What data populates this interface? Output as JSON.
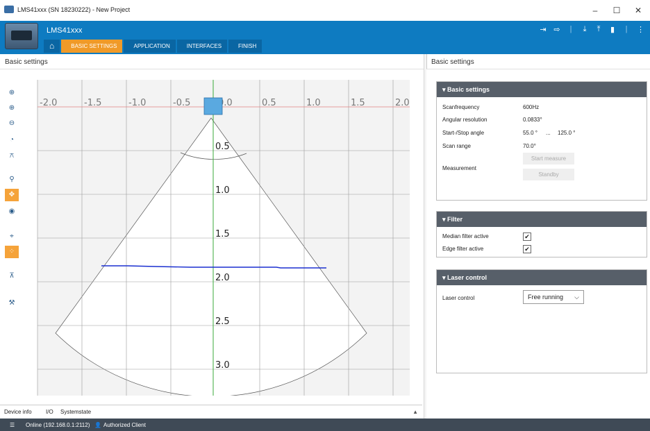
{
  "window": {
    "title": "LMS41xxx (SN 18230222) - New Project",
    "controls": [
      "–",
      "☐",
      "✕"
    ]
  },
  "header": {
    "device_name": "LMS41xxx",
    "icons": [
      "login-icon",
      "logout-icon",
      "download-icon",
      "upload-icon",
      "device-icon",
      "more-icon"
    ],
    "breadcrumb": [
      {
        "label": "BASIC SETTINGS",
        "active": true
      },
      {
        "label": "APPLICATION",
        "active": false
      },
      {
        "label": "INTERFACES",
        "active": false
      },
      {
        "label": "FINISH",
        "active": false
      }
    ]
  },
  "left": {
    "title": "Basic settings",
    "tools": [
      "zoom-in-icon",
      "zoom-in-2-icon",
      "zoom-out-icon",
      "scan-icon",
      "scan-2-icon",
      "search-icon",
      "pan-icon",
      "point-icon",
      "measure-icon",
      "grid-icon",
      "align-icon",
      "wrench-icon"
    ],
    "bottom_tabs": [
      "Device info",
      "I/O",
      "Systemstate"
    ]
  },
  "plot": {
    "x_ticks": [
      "-2.0",
      "-1.5",
      "-1.0",
      "-0.5",
      "0.0",
      "0.5",
      "1.0",
      "1.5",
      "2.0"
    ],
    "y_ticks": [
      "0.5",
      "1.0",
      "1.5",
      "2.0",
      "2.5",
      "3.0"
    ]
  },
  "right": {
    "title": "Basic settings",
    "basic": {
      "head": "▾  Basic settings",
      "scanfrequency_label": "Scanfrequency",
      "scanfrequency": "600Hz",
      "angular_label": "Angular resolution",
      "angular": "0.0833°",
      "startstop_label": "Start-/Stop angle",
      "start": "55.0 °",
      "sep": "...",
      "stop": "125.0 °",
      "range_label": "Scan range",
      "range": "70.0°",
      "measurement_label": "Measurement",
      "start_measure": "Start measure",
      "standby": "Standby"
    },
    "filter": {
      "head": "▾  Filter",
      "median_label": "Median filter active",
      "edge_label": "Edge filter active",
      "check": "✔"
    },
    "laser": {
      "head": "▾  Laser control",
      "label": "Laser control",
      "value": "Free running",
      "chev": "⌵"
    }
  },
  "status": {
    "online": "Online (192.168.0.1:2112)",
    "client": "Authorized Client"
  }
}
